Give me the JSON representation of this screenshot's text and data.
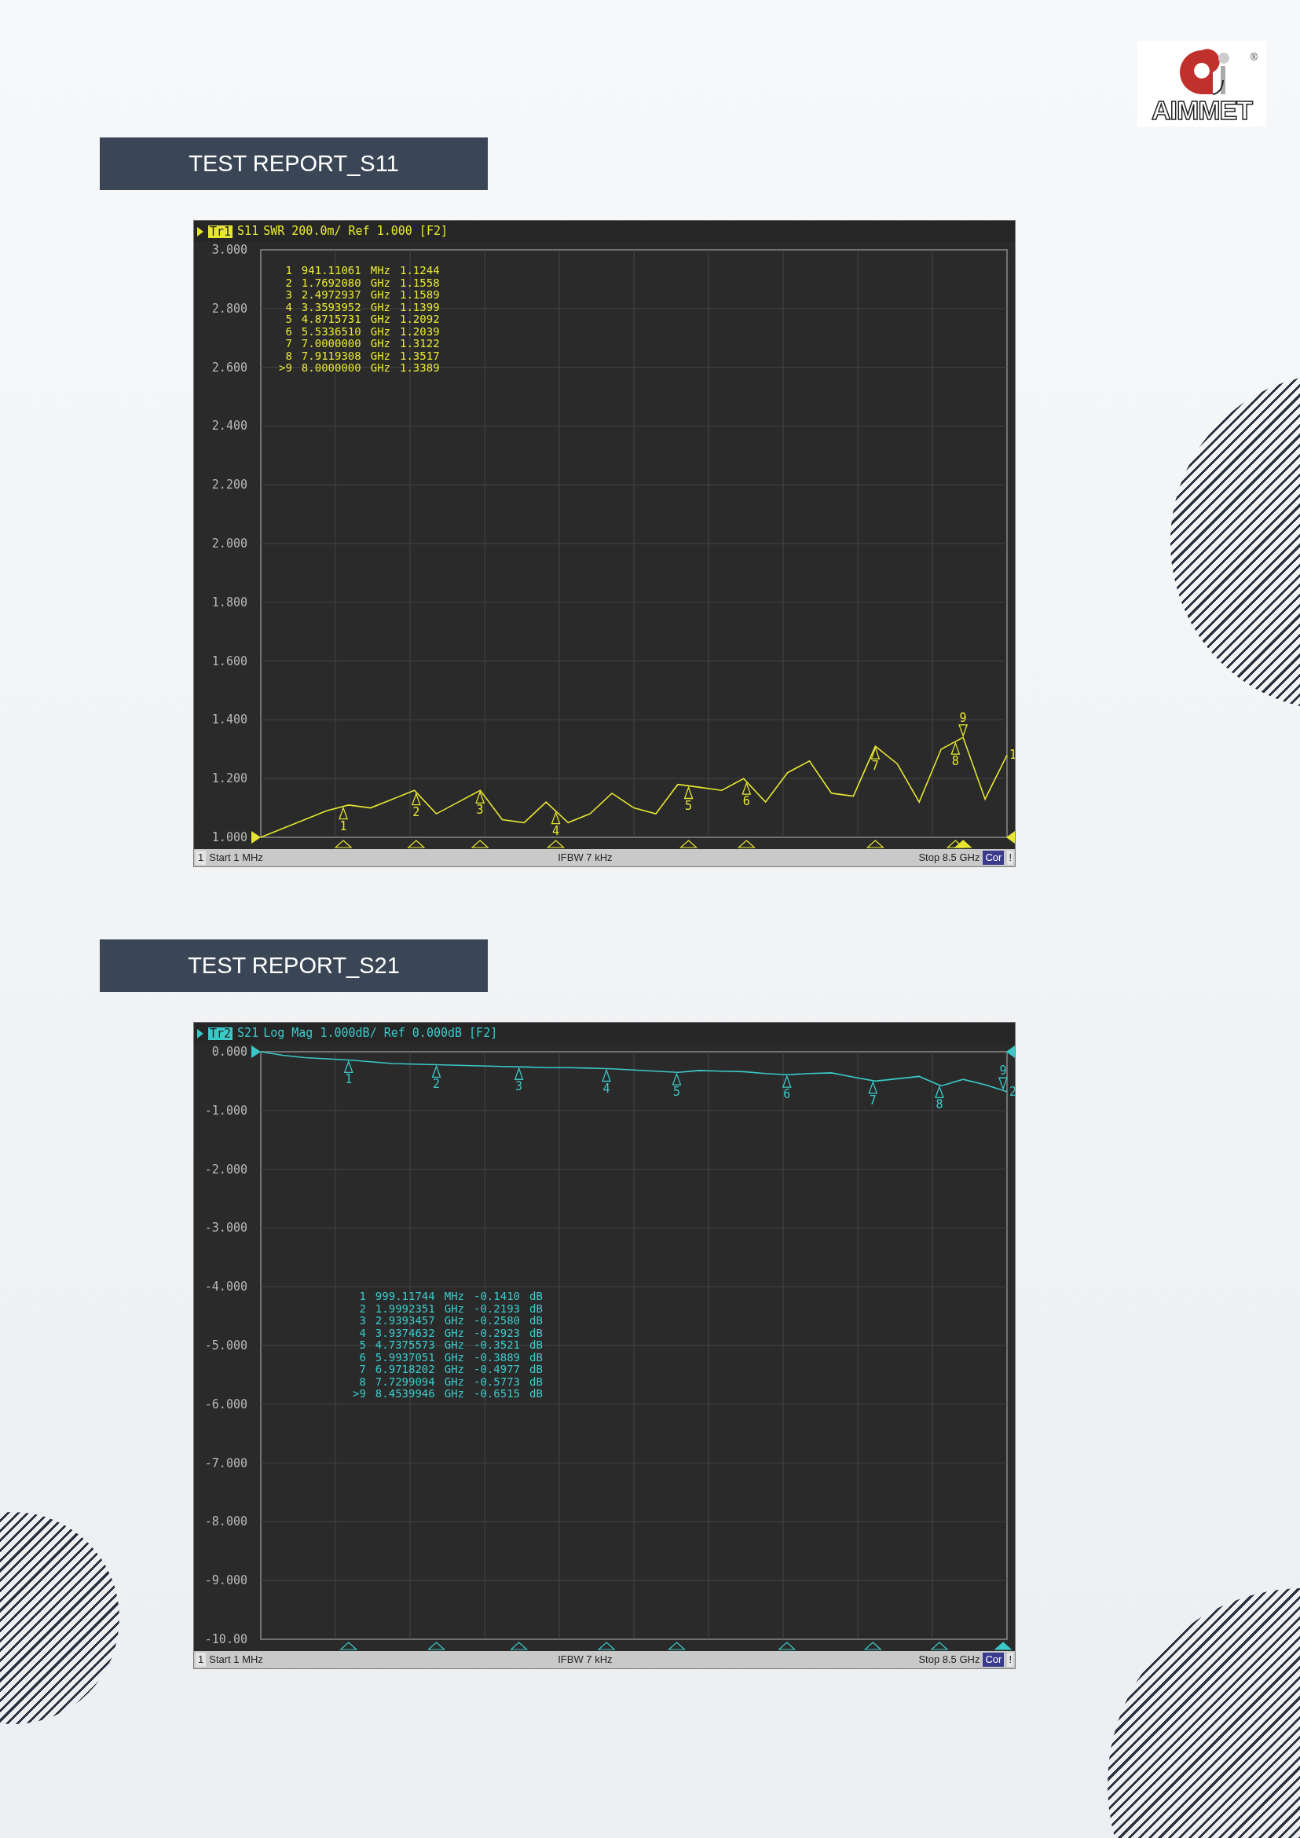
{
  "logo": {
    "text": "AIMMET",
    "registered": "®"
  },
  "panels": [
    {
      "heading": "TEST REPORT_S11",
      "trace_badge": "Tr1",
      "header": "SWR 200.0m/ Ref 1.000 [F2]",
      "trace_label": "1",
      "marker_table": [
        {
          "marker": "1",
          "frequency": "941.11061",
          "unit": "MHz",
          "reading": "1.1244"
        },
        {
          "marker": "2",
          "frequency": "1.7692080",
          "unit": "GHz",
          "reading": "1.1558"
        },
        {
          "marker": "3",
          "frequency": "2.4972937",
          "unit": "GHz",
          "reading": "1.1589"
        },
        {
          "marker": "4",
          "frequency": "3.3593952",
          "unit": "GHz",
          "reading": "1.1399"
        },
        {
          "marker": "5",
          "frequency": "4.8715731",
          "unit": "GHz",
          "reading": "1.2092"
        },
        {
          "marker": "6",
          "frequency": "5.5336510",
          "unit": "GHz",
          "reading": "1.2039"
        },
        {
          "marker": "7",
          "frequency": "7.0000000",
          "unit": "GHz",
          "reading": "1.3122"
        },
        {
          "marker": "8",
          "frequency": "7.9119308",
          "unit": "GHz",
          "reading": "1.3517"
        },
        {
          "marker": ">9",
          "frequency": "8.0000000",
          "unit": "GHz",
          "reading": "1.3389"
        }
      ],
      "footer": {
        "channel": "1",
        "start": "Start 1 MHz",
        "ifbw": "IFBW 7 kHz",
        "stop": "Stop 8.5 GHz",
        "correction": "Cor",
        "warning": "!"
      },
      "chart_data": {
        "type": "line",
        "ylim": [
          1,
          3
        ],
        "yticks": [
          {
            "value": 3,
            "label": "3.000"
          },
          {
            "value": 2.8,
            "label": "2.800"
          },
          {
            "value": 2.6,
            "label": "2.600"
          },
          {
            "value": 2.4,
            "label": "2.400"
          },
          {
            "value": 2.2,
            "label": "2.200"
          },
          {
            "value": 2,
            "label": "2.000"
          },
          {
            "value": 1.8,
            "label": "1.800"
          },
          {
            "value": 1.6,
            "label": "1.600"
          },
          {
            "value": 1.4,
            "label": "1.400"
          },
          {
            "value": 1.2,
            "label": "1.200"
          },
          {
            "value": 1,
            "label": "1.000"
          }
        ],
        "categories": [
          null,
          null,
          null,
          null,
          null,
          null,
          null,
          null,
          null,
          null,
          null,
          null,
          null,
          null,
          null,
          null,
          null,
          null,
          null,
          null,
          null,
          null,
          null,
          null,
          null,
          null,
          null,
          null,
          null,
          null,
          null,
          null,
          null,
          null,
          null
        ],
        "series": [
          {
            "name": "S11",
            "color": "#e6e632",
            "values": [
              1.0,
              1.03,
              1.06,
              1.09,
              1.11,
              1.1,
              1.13,
              1.16,
              1.08,
              1.12,
              1.16,
              1.06,
              1.05,
              1.12,
              1.05,
              1.08,
              1.15,
              1.1,
              1.08,
              1.18,
              1.17,
              1.16,
              1.2,
              1.12,
              1.22,
              1.26,
              1.15,
              1.14,
              1.31,
              1.25,
              1.12,
              1.3,
              1.34,
              1.13,
              1.28
            ]
          }
        ],
        "grid": true,
        "annotations": [
          {
            "text": "1"
          },
          {
            "text": "2"
          },
          {
            "text": "3"
          },
          {
            "text": "4"
          },
          {
            "text": "5"
          },
          {
            "text": "6"
          },
          {
            "text": "7"
          },
          {
            "text": "8"
          },
          {
            "text": "9"
          }
        ]
      }
    },
    {
      "heading": "TEST REPORT_S21",
      "trace_badge": "Tr2",
      "header": "Log Mag 1.000dB/ Ref 0.000dB [F2]",
      "trace_label": "2",
      "marker_table": [
        {
          "marker": "1",
          "frequency": "999.11744",
          "unit": "MHz",
          "reading": "-0.1410",
          "reading_unit": "dB"
        },
        {
          "marker": "2",
          "frequency": "1.9992351",
          "unit": "GHz",
          "reading": "-0.2193",
          "reading_unit": "dB"
        },
        {
          "marker": "3",
          "frequency": "2.9393457",
          "unit": "GHz",
          "reading": "-0.2580",
          "reading_unit": "dB"
        },
        {
          "marker": "4",
          "frequency": "3.9374632",
          "unit": "GHz",
          "reading": "-0.2923",
          "reading_unit": "dB"
        },
        {
          "marker": "5",
          "frequency": "4.7375573",
          "unit": "GHz",
          "reading": "-0.3521",
          "reading_unit": "dB"
        },
        {
          "marker": "6",
          "frequency": "5.9937051",
          "unit": "GHz",
          "reading": "-0.3889",
          "reading_unit": "dB"
        },
        {
          "marker": "7",
          "frequency": "6.9718202",
          "unit": "GHz",
          "reading": "-0.4977",
          "reading_unit": "dB"
        },
        {
          "marker": "8",
          "frequency": "7.7299094",
          "unit": "GHz",
          "reading": "-0.5773",
          "reading_unit": "dB"
        },
        {
          "marker": ">9",
          "frequency": "8.4539946",
          "unit": "GHz",
          "reading": "-0.6515",
          "reading_unit": "dB"
        }
      ],
      "footer": {
        "channel": "1",
        "start": "Start 1 MHz",
        "ifbw": "IFBW 7 kHz",
        "stop": "Stop 8.5 GHz",
        "correction": "Cor",
        "warning": "!"
      },
      "chart_data": {
        "type": "line",
        "ylim": [
          -10,
          0
        ],
        "yticks": [
          {
            "value": 0,
            "label": "0.000"
          },
          {
            "value": -1,
            "label": "-1.000"
          },
          {
            "value": -2,
            "label": "-2.000"
          },
          {
            "value": -3,
            "label": "-3.000"
          },
          {
            "value": -4,
            "label": "-4.000"
          },
          {
            "value": -5,
            "label": "-5.000"
          },
          {
            "value": -6,
            "label": "-6.000"
          },
          {
            "value": -7,
            "label": "-7.000"
          },
          {
            "value": -8,
            "label": "-8.000"
          },
          {
            "value": -9,
            "label": "-9.000"
          },
          {
            "value": -10,
            "label": "-10.00"
          }
        ],
        "categories": [
          null,
          null,
          null,
          null,
          null,
          null,
          null,
          null,
          null,
          null,
          null,
          null,
          null,
          null,
          null,
          null,
          null,
          null,
          null,
          null,
          null,
          null,
          null,
          null,
          null,
          null,
          null,
          null,
          null,
          null,
          null,
          null,
          null,
          null,
          null
        ],
        "series": [
          {
            "name": "S21",
            "color": "#3cc8c8",
            "values": [
              0,
              -0.06,
              -0.1,
              -0.12,
              -0.14,
              -0.17,
              -0.2,
              -0.21,
              -0.22,
              -0.23,
              -0.24,
              -0.25,
              -0.26,
              -0.27,
              -0.27,
              -0.28,
              -0.29,
              -0.31,
              -0.33,
              -0.35,
              -0.32,
              -0.33,
              -0.34,
              -0.37,
              -0.39,
              -0.37,
              -0.36,
              -0.43,
              -0.5,
              -0.46,
              -0.42,
              -0.58,
              -0.47,
              -0.56,
              -0.68
            ]
          }
        ],
        "grid": true,
        "annotations": [
          {
            "text": "1"
          },
          {
            "text": "2"
          },
          {
            "text": "3"
          },
          {
            "text": "4"
          },
          {
            "text": "5"
          },
          {
            "text": "6"
          },
          {
            "text": "7"
          },
          {
            "text": "8"
          },
          {
            "text": "9"
          }
        ]
      }
    }
  ]
}
